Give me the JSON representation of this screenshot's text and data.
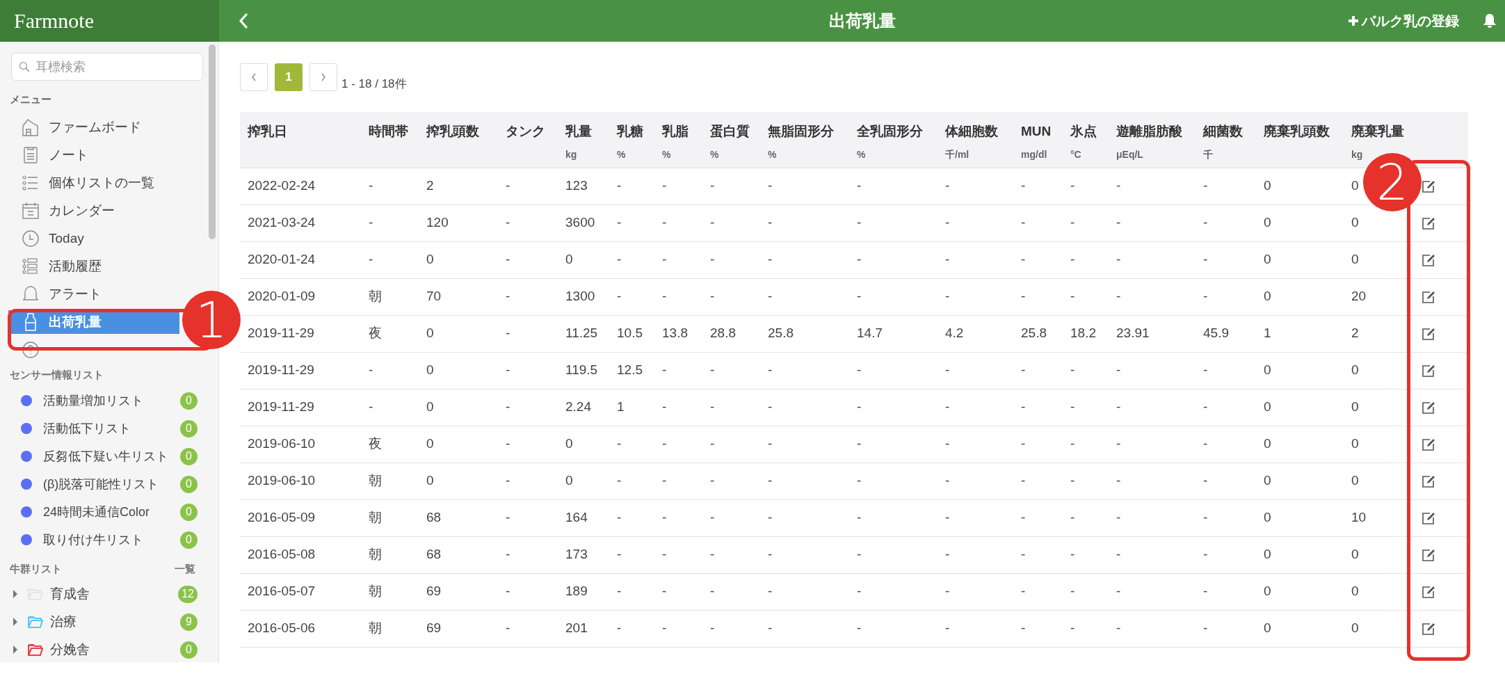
{
  "app": {
    "logo": "Farmnote"
  },
  "header": {
    "title": "出荷乳量",
    "action": "バルク乳の登録"
  },
  "sidebar": {
    "search": {
      "placeholder": "耳標検索"
    },
    "menu_heading": "メニュー",
    "menu": [
      {
        "label": "ファームボード",
        "selected": false
      },
      {
        "label": "ノート",
        "selected": false
      },
      {
        "label": "個体リストの一覧",
        "selected": false
      },
      {
        "label": "カレンダー",
        "selected": false
      },
      {
        "label": "Today",
        "selected": false
      },
      {
        "label": "活動履歴",
        "selected": false
      },
      {
        "label": "アラート",
        "selected": false
      },
      {
        "label": "出荷乳量",
        "selected": true
      },
      {
        "selected": false
      }
    ],
    "sensor_heading": "センサー情報リスト",
    "sensor_lists": [
      {
        "label": "活動量増加リスト",
        "count": "0"
      },
      {
        "label": "活動低下リスト",
        "count": "0"
      },
      {
        "label": "反芻低下疑い牛リスト",
        "count": "0"
      },
      {
        "label": "(β)脱落可能性リスト",
        "count": "0"
      },
      {
        "label": "24時間未通信Color",
        "count": "0"
      },
      {
        "label": "取り付け牛リスト",
        "count": "0"
      }
    ],
    "herd_heading": "牛群リスト",
    "herd_link": "一覧",
    "herds": [
      {
        "label": "育成舎",
        "count": "12",
        "color": "#e6e6e6"
      },
      {
        "label": "治療",
        "count": "9",
        "color": "#5bc8f0"
      },
      {
        "label": "分娩舎",
        "count": "0",
        "color": "#e8434b"
      }
    ]
  },
  "pagination": {
    "pages": [
      {
        "label": "1",
        "selected": true
      }
    ],
    "summary": "1 - 18 / 18件"
  },
  "table": {
    "columns": [
      {
        "label": "搾乳日"
      },
      {
        "label": "時間帯"
      },
      {
        "label": "搾乳頭数"
      },
      {
        "label": "タンク"
      },
      {
        "label": "乳量",
        "unit": "kg"
      },
      {
        "label": "乳糖",
        "unit": "%"
      },
      {
        "label": "乳脂",
        "unit": "%"
      },
      {
        "label": "蛋白質",
        "unit": "%"
      },
      {
        "label": "無脂固形分",
        "unit": "%"
      },
      {
        "label": "全乳固形分",
        "unit": "%"
      },
      {
        "label": "体細胞数",
        "unit": "千/ml"
      },
      {
        "label": "MUN",
        "unit": "mg/dl"
      },
      {
        "label": "氷点",
        "unit": "°C"
      },
      {
        "label": "遊離脂肪酸",
        "unit": "μEq/L"
      },
      {
        "label": "細菌数",
        "unit": "千"
      },
      {
        "label": "廃棄乳頭数"
      },
      {
        "label": "廃棄乳量",
        "unit": "kg"
      }
    ],
    "rows": [
      {
        "cells": [
          "2022-02-24",
          "-",
          "2",
          "-",
          "123",
          "-",
          "-",
          "-",
          "-",
          "-",
          "-",
          "-",
          "-",
          "-",
          "-",
          "0",
          "0"
        ]
      },
      {
        "cells": [
          "2021-03-24",
          "-",
          "120",
          "-",
          "3600",
          "-",
          "-",
          "-",
          "-",
          "-",
          "-",
          "-",
          "-",
          "-",
          "-",
          "0",
          "0"
        ]
      },
      {
        "cells": [
          "2020-01-24",
          "-",
          "0",
          "-",
          "0",
          "-",
          "-",
          "-",
          "-",
          "-",
          "-",
          "-",
          "-",
          "-",
          "-",
          "0",
          "0"
        ]
      },
      {
        "cells": [
          "2020-01-09",
          "朝",
          "70",
          "-",
          "1300",
          "-",
          "-",
          "-",
          "-",
          "-",
          "-",
          "-",
          "-",
          "-",
          "-",
          "0",
          "20"
        ]
      },
      {
        "cells": [
          "2019-11-29",
          "夜",
          "0",
          "-",
          "11.25",
          "10.5",
          "13.8",
          "28.8",
          "25.8",
          "14.7",
          "4.2",
          "25.8",
          "18.2",
          "23.91",
          "45.9",
          "1",
          "2"
        ]
      },
      {
        "cells": [
          "2019-11-29",
          "-",
          "0",
          "-",
          "119.5",
          "12.5",
          "-",
          "-",
          "-",
          "-",
          "-",
          "-",
          "-",
          "-",
          "-",
          "0",
          "0"
        ]
      },
      {
        "cells": [
          "2019-11-29",
          "-",
          "0",
          "-",
          "2.24",
          "1",
          "-",
          "-",
          "-",
          "-",
          "-",
          "-",
          "-",
          "-",
          "-",
          "0",
          "0"
        ]
      },
      {
        "cells": [
          "2019-06-10",
          "夜",
          "0",
          "-",
          "0",
          "-",
          "-",
          "-",
          "-",
          "-",
          "-",
          "-",
          "-",
          "-",
          "-",
          "0",
          "0"
        ]
      },
      {
        "cells": [
          "2019-06-10",
          "朝",
          "0",
          "-",
          "0",
          "-",
          "-",
          "-",
          "-",
          "-",
          "-",
          "-",
          "-",
          "-",
          "-",
          "0",
          "0"
        ]
      },
      {
        "cells": [
          "2016-05-09",
          "朝",
          "68",
          "-",
          "164",
          "-",
          "-",
          "-",
          "-",
          "-",
          "-",
          "-",
          "-",
          "-",
          "-",
          "0",
          "10"
        ]
      },
      {
        "cells": [
          "2016-05-08",
          "朝",
          "68",
          "-",
          "173",
          "-",
          "-",
          "-",
          "-",
          "-",
          "-",
          "-",
          "-",
          "-",
          "-",
          "0",
          "0"
        ]
      },
      {
        "cells": [
          "2016-05-07",
          "朝",
          "69",
          "-",
          "189",
          "-",
          "-",
          "-",
          "-",
          "-",
          "-",
          "-",
          "-",
          "-",
          "-",
          "0",
          "0"
        ]
      },
      {
        "cells": [
          "2016-05-06",
          "朝",
          "69",
          "-",
          "201",
          "-",
          "-",
          "-",
          "-",
          "-",
          "-",
          "-",
          "-",
          "-",
          "-",
          "0",
          "0"
        ]
      }
    ]
  },
  "annotations": [
    {
      "label": "1"
    },
    {
      "label": "2"
    }
  ]
}
